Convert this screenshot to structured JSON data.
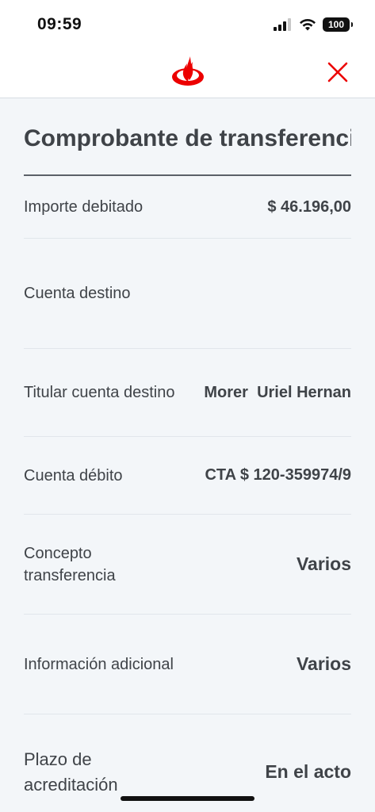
{
  "status_bar": {
    "time": "09:59",
    "battery": "100"
  },
  "header": {
    "logo_icon": "santander-flame-icon",
    "close_icon": "close-icon",
    "brand_color": "#ec0000"
  },
  "page": {
    "title": "Comprobante de transferencia"
  },
  "rows": [
    {
      "label": "Importe debitado",
      "value": "$ 46.196,00"
    },
    {
      "label": "Cuenta destino",
      "value": ""
    },
    {
      "label": "Titular cuenta destino",
      "value": "Morer  Uriel Hernan"
    },
    {
      "label": "Cuenta débito",
      "value": "CTA $ 120-359974/9"
    },
    {
      "label": "Concepto transferencia",
      "value": "Varios"
    },
    {
      "label": "Información adicional",
      "value": "Varios"
    },
    {
      "label": "Plazo de acreditación",
      "value": "En el acto"
    }
  ]
}
